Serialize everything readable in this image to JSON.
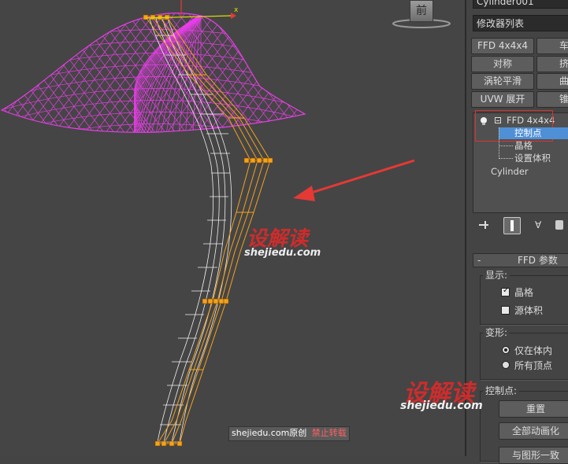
{
  "viewport": {
    "axis_x_label": "x",
    "view_cube_label": "前",
    "annotation_color": "#e53935",
    "wireframe_color": "#e83ee8",
    "lattice_color": "#f5a21c"
  },
  "watermark": {
    "brand_cn": "设解读",
    "brand_url": "shejiedu.com",
    "footer_site": "shejiedu.com",
    "footer_original": "原创",
    "footer_forbidden": "禁止转载"
  },
  "panel": {
    "object_name": "Cylinder001",
    "modifier_list": "修改器列表",
    "buttons": [
      {
        "left": "FFD 4x4x4",
        "right": "车"
      },
      {
        "left": "对称",
        "right": "挤"
      },
      {
        "left": "涡轮平滑",
        "right": "曲"
      },
      {
        "left": "UVW 展开",
        "right": "锥"
      }
    ],
    "stack": {
      "modifier": "FFD 4x4x4",
      "sub_items": [
        "控制点",
        "晶格",
        "设置体积"
      ],
      "selected_index": 0,
      "base_object": "Cylinder"
    },
    "ffd_params": {
      "collapse": "-",
      "title": "FFD 参数",
      "display_label": "显示:",
      "lattice": "晶格",
      "lattice_checked": true,
      "source_volume": "源体积",
      "source_volume_checked": false,
      "deform_label": "变形:",
      "only_in_volume": "仅在体内",
      "all_vertices": "所有顶点",
      "control_points_label": "控制点:",
      "reset": "重置",
      "animate_all": "全部动画化",
      "conform": "与图形一致"
    }
  }
}
